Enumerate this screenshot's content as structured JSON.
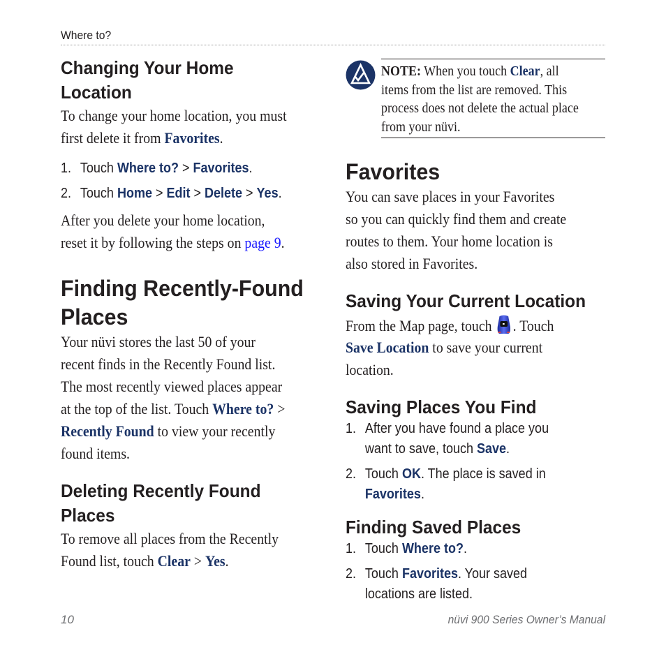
{
  "running_head": "Where to?",
  "left_column": {
    "changing_home": {
      "heading_line1": "Changing Your Home",
      "heading_line2": "Location",
      "intro_line1": "To change your home location, you must",
      "intro_line2_pre": "first delete it from ",
      "intro_line2_kw": "Favorites",
      "intro_line2_post": ".",
      "steps": [
        {
          "num": "1.",
          "pre": "Touch ",
          "kw1": "Where to?",
          "sep1": " > ",
          "kw2": "Favorites",
          "post": "."
        },
        {
          "num": "2.",
          "pre": "Touch ",
          "kw1": "Home",
          "sep1": " > ",
          "kw2": "Edit",
          "sep2": " > ",
          "kw3": "Delete",
          "sep3": " > ",
          "kw4": "Yes",
          "post": "."
        }
      ],
      "after_line1": "After you delete your home location,",
      "after_line2_pre": "reset it by following the steps on ",
      "after_link": "page 9",
      "after_line2_post": "."
    },
    "recently_found": {
      "heading_line1": "Finding Recently-Found",
      "heading_line2": "Places",
      "lines": [
        "Your nüvi stores the last 50 of your",
        "recent finds in the Recently Found list.",
        "The most recently viewed places appear"
      ],
      "line4_pre": "at the top of the list. Touch ",
      "line4_kw": "Where to?",
      "line4_post": " >",
      "line5_kw": "Recently Found",
      "line5_post": " to view your recently",
      "line6": "found items."
    },
    "deleting": {
      "heading_line1": "Deleting Recently Found",
      "heading_line2": "Places",
      "line1": "To remove all places from the Recently",
      "line2_pre": "Found list, touch ",
      "line2_kw1": "Clear",
      "line2_sep": " > ",
      "line2_kw2": "Yes",
      "line2_post": "."
    }
  },
  "right_column": {
    "note": {
      "icon": "note-icon",
      "label": "NOTE:",
      "line1_pre": " When you touch ",
      "line1_kw": "Clear",
      "line1_post": ", all",
      "line2": "items from the list are removed. This",
      "line3": "process does not delete the actual place",
      "line4": "from your nüvi."
    },
    "favorites": {
      "heading": "Favorites",
      "lines": [
        "You can save places in your Favorites",
        "so you can quickly find them and create",
        "routes to them. Your home location is",
        "also stored in Favorites."
      ]
    },
    "saving_current": {
      "heading": "Saving Your Current Location",
      "line1_pre": "From the Map page, touch ",
      "line1_icon": "vehicle-icon",
      "line1_post": ". Touch",
      "line2_kw": "Save Location",
      "line2_post": " to save your current",
      "line3": "location."
    },
    "saving_places": {
      "heading": "Saving Places You Find",
      "step1_num": "1.",
      "step1_line1": "After you have found a place you",
      "step1_line2_pre": "want to save, touch ",
      "step1_kw": "Save",
      "step1_post": ".",
      "step2_num": "2.",
      "step2_pre": "Touch ",
      "step2_kw": "OK",
      "step2_post": ". The place is saved in",
      "step2_line2_kw": "Favorites",
      "step2_line2_post": "."
    },
    "finding_saved": {
      "heading": "Finding Saved Places",
      "step1_num": "1.",
      "step1_pre": "Touch ",
      "step1_kw": "Where to?",
      "step1_post": ".",
      "step2_num": "2.",
      "step2_pre": "Touch ",
      "step2_kw": "Favorites",
      "step2_post": ". Your saved",
      "step2_line2": "locations are listed."
    }
  },
  "footer": {
    "page_number": "10",
    "manual_title": "nüvi 900 Series Owner’s Manual"
  },
  "colors": {
    "keyword": "#1b3366",
    "link": "#1a1aff",
    "text": "#231f20",
    "footer": "#6d6e71"
  }
}
